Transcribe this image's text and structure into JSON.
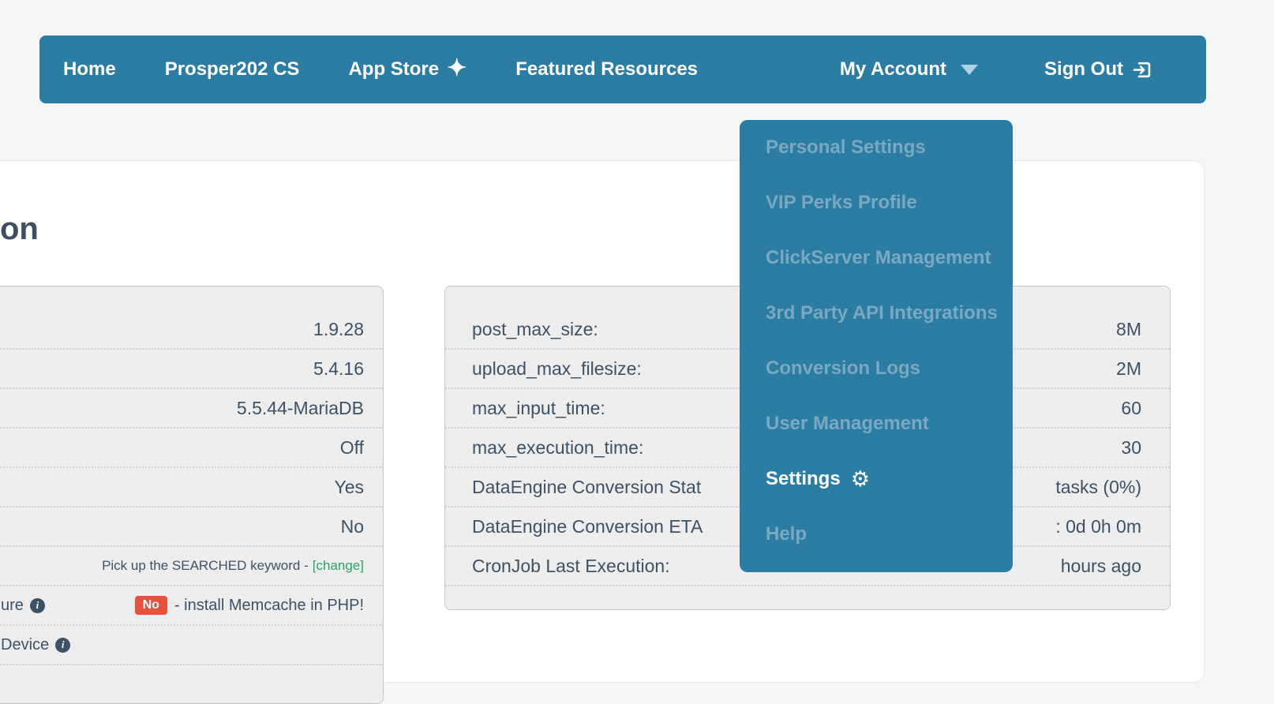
{
  "navbar": {
    "items": [
      {
        "label": "Home"
      },
      {
        "label": "Prosper202 CS"
      },
      {
        "label": "App Store",
        "icon": "✦"
      },
      {
        "label": "Featured Resources"
      }
    ],
    "my_account": "My Account",
    "sign_out": "Sign Out"
  },
  "account_menu": {
    "items": [
      "Personal Settings",
      "VIP Perks Profile",
      "ClickServer Management",
      "3rd Party API Integrations",
      "Conversion Logs",
      "User Management"
    ],
    "settings": "Settings",
    "settings_icon": "⚙",
    "help": "Help"
  },
  "page": {
    "heading_fragment": "on"
  },
  "left_panel": {
    "values": [
      "1.9.28",
      "5.4.16",
      "5.5.44-MariaDB",
      "Off",
      "Yes",
      "No"
    ],
    "searched_row": {
      "text": "Pick up the SEARCHED keyword -",
      "link": "[change]"
    },
    "memcache_row": {
      "label_fragment": "ure",
      "badge": "No",
      "text": "- install Memcache in PHP!"
    },
    "partial_row": {
      "label_fragment": "Device"
    }
  },
  "right_panel": {
    "rows": [
      {
        "label": "post_max_size:",
        "value": "8M"
      },
      {
        "label": "upload_max_filesize:",
        "value": "2M"
      },
      {
        "label": "max_input_time:",
        "value": "60"
      },
      {
        "label": "max_execution_time:",
        "value": "30"
      },
      {
        "label": "DataEngine Conversion Stat",
        "value": "tasks (0%)"
      },
      {
        "label": "DataEngine Conversion ETA",
        "value": ": 0d 0h 0m"
      },
      {
        "label": "CronJob Last Execution:",
        "value": "hours ago"
      }
    ]
  },
  "icons": {
    "info": "i"
  },
  "colors": {
    "nav_blue": "#2b7da4",
    "muted_menu_text": "#79a9c1",
    "navy_text": "#3d5265",
    "green_link": "#29a469",
    "red_badge": "#e8513e",
    "panel_bg": "#ededee"
  }
}
